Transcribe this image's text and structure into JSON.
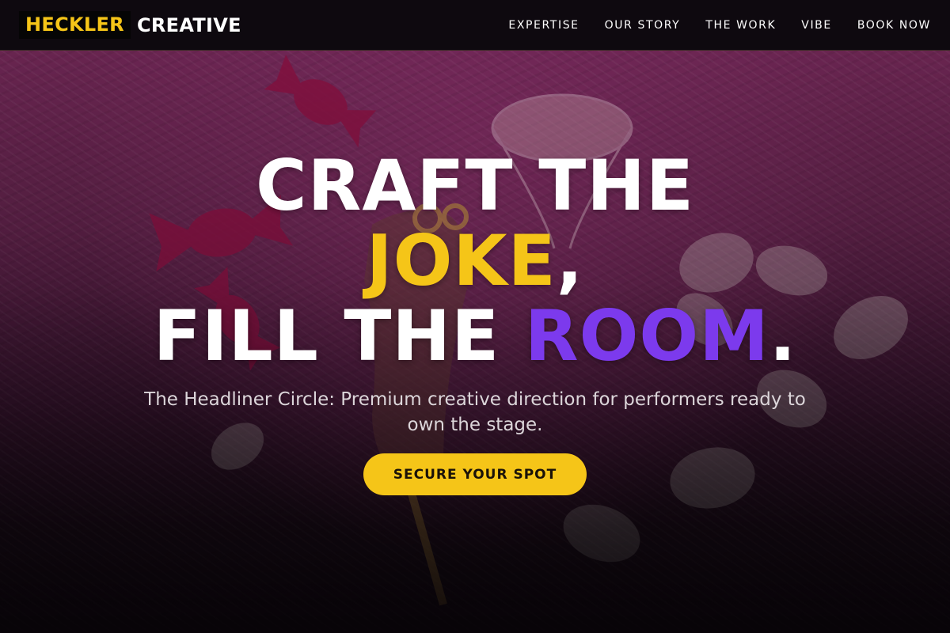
{
  "brand": {
    "name_first": "HECKLER",
    "name_second": "CREATIVE"
  },
  "nav": {
    "items": [
      {
        "label": "EXPERTISE"
      },
      {
        "label": "OUR STORY"
      },
      {
        "label": "THE WORK"
      },
      {
        "label": "VIBE"
      },
      {
        "label": "BOOK NOW"
      }
    ]
  },
  "hero": {
    "headline": {
      "line1": "CRAFT THE",
      "line2_highlight": "JOKE",
      "line2_punct": ",",
      "line3_text": "FILL THE ",
      "line3_highlight": "ROOM",
      "line3_punct": "."
    },
    "subtitle": "The Headliner Circle: Premium creative direction for performers ready to own the stage.",
    "cta_label": "SECURE YOUR SPOT",
    "background_image": "pink-fur-with-candies-and-cocktail-glass"
  },
  "colors": {
    "accent_yellow": "#f5c518",
    "accent_purple": "#7c3aed",
    "header_bg": "#0e090f",
    "text_white": "#ffffff"
  }
}
